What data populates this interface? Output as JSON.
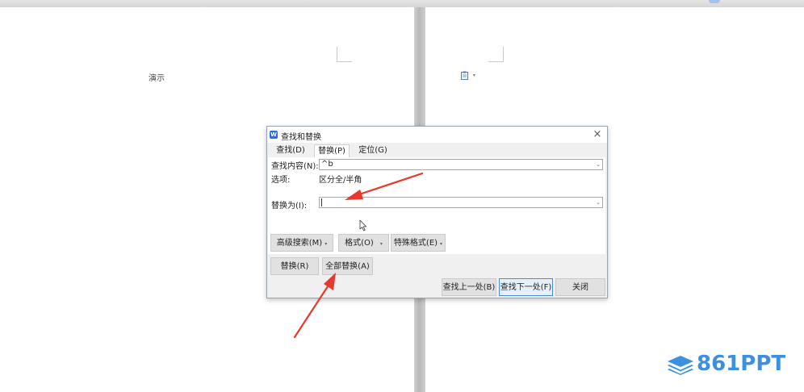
{
  "document": {
    "left_page_text": "演示"
  },
  "dialog": {
    "title": "查找和替换",
    "close_glyph": "×",
    "tabs": [
      {
        "label": "查找(D)"
      },
      {
        "label": "替换(P)"
      },
      {
        "label": "定位(G)"
      }
    ],
    "active_tab": "替换(P)",
    "find_label": "查找内容(N):",
    "find_value": "^b",
    "options_label": "选项:",
    "options_value": "区分全/半角",
    "replace_label": "替换为(I):",
    "replace_value": "",
    "buttons": {
      "advanced_search": "高级搜索(M)",
      "format": "格式(O)",
      "special_format": "特殊格式(E)",
      "replace": "替换(R)",
      "replace_all": "全部替换(A)",
      "find_previous": "查找上一处(B)",
      "find_next": "查找下一处(F)",
      "close": "关闭"
    }
  },
  "watermark": {
    "text": "861PPT"
  },
  "colors": {
    "accent": "#2b6fd6",
    "annotation_arrow": "#e8372c",
    "brand": "#3d8fe0"
  }
}
